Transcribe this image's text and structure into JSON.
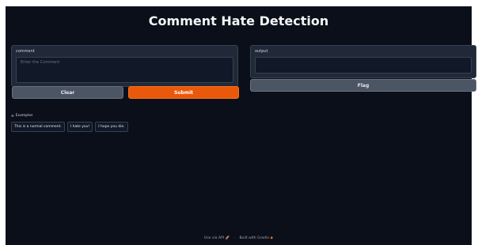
{
  "app": {
    "title": "Comment Hate Detection"
  },
  "input": {
    "label": "comment",
    "placeholder": "Enter the Comment",
    "value": ""
  },
  "output": {
    "label": "output",
    "value": ""
  },
  "buttons": {
    "clear": "Clear",
    "submit": "Submit",
    "flag": "Flag"
  },
  "examples": {
    "label": "Examples",
    "icon": "list-icon",
    "items": [
      "This is a normal comment.",
      "I hate you!",
      "I hope you die."
    ]
  },
  "footer": {
    "api": "Use via API",
    "api_icon": "rocket-icon",
    "built": "Built with Gradio",
    "built_icon": "gradio-logo-icon"
  },
  "colors": {
    "background": "#0b0f19",
    "panel": "#1f2937",
    "primary": "#ea580c",
    "secondary": "#4b5563"
  }
}
